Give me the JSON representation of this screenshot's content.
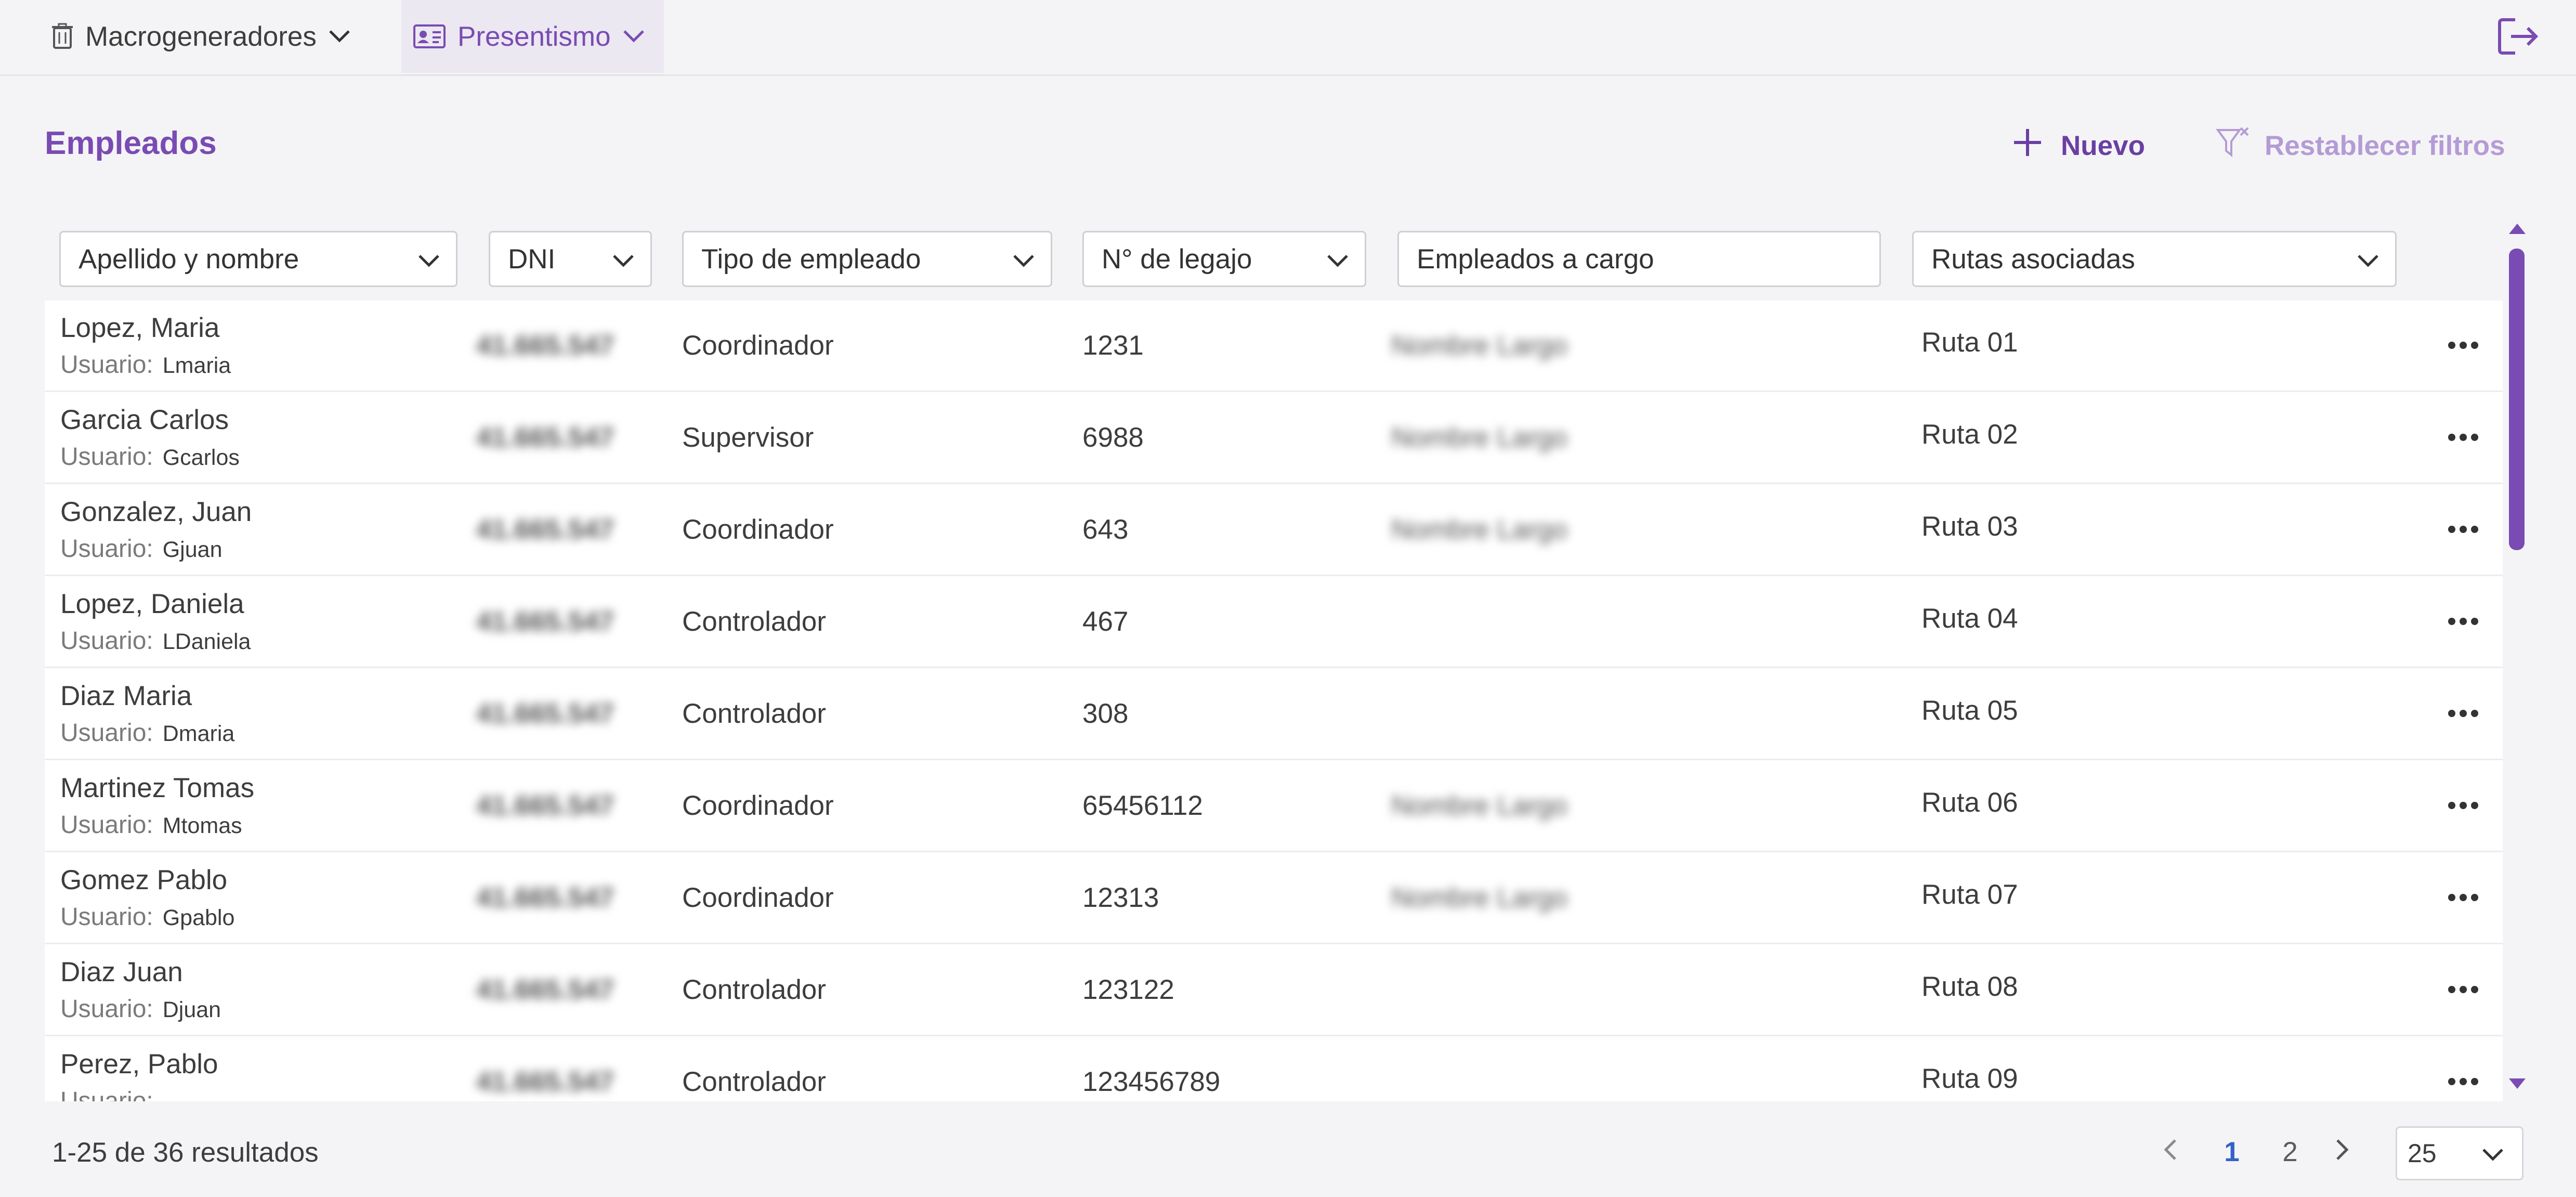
{
  "nav": {
    "item1": {
      "label": "Macrogeneradores",
      "icon": "trash-icon"
    },
    "item2": {
      "label": "Presentismo",
      "icon": "id-card-icon"
    }
  },
  "header": {
    "title": "Empleados",
    "new_label": "Nuevo",
    "reset_label": "Restablecer filtros"
  },
  "filters": {
    "name": "Apellido y nombre",
    "dni": "DNI",
    "tipo": "Tipo de empleado",
    "legajo": "N° de legajo",
    "a_cargo": "Empleados a cargo",
    "rutas": "Rutas asociadas"
  },
  "user_label": "Usuario:",
  "rows": [
    {
      "name": "Lopez, Maria",
      "user": "Lmaria",
      "dni": "41.665.547",
      "tipo": "Coordinador",
      "legajo": "1231",
      "a_cargo": "Nombre Largo",
      "ruta": "Ruta 01"
    },
    {
      "name": "Garcia Carlos",
      "user": "Gcarlos",
      "dni": "41.665.547",
      "tipo": "Supervisor",
      "legajo": "6988",
      "a_cargo": "Nombre Largo",
      "ruta": "Ruta 02"
    },
    {
      "name": "Gonzalez, Juan",
      "user": "Gjuan",
      "dni": "41.665.547",
      "tipo": "Coordinador",
      "legajo": "643",
      "a_cargo": "Nombre Largo",
      "ruta": "Ruta 03"
    },
    {
      "name": "Lopez, Daniela",
      "user": "LDaniela",
      "dni": "41.665.547",
      "tipo": "Controlador",
      "legajo": "467",
      "a_cargo": "",
      "ruta": "Ruta 04"
    },
    {
      "name": "Diaz Maria",
      "user": "Dmaria",
      "dni": "41.665.547",
      "tipo": "Controlador",
      "legajo": "308",
      "a_cargo": "",
      "ruta": "Ruta 05"
    },
    {
      "name": "Martinez Tomas",
      "user": "Mtomas",
      "dni": "41.665.547",
      "tipo": "Coordinador",
      "legajo": "65456112",
      "a_cargo": "Nombre Largo",
      "ruta": "Ruta 06"
    },
    {
      "name": "Gomez Pablo",
      "user": "Gpablo",
      "dni": "41.665.547",
      "tipo": "Coordinador",
      "legajo": "12313",
      "a_cargo": "Nombre Largo",
      "ruta": "Ruta 07"
    },
    {
      "name": "Diaz Juan",
      "user": "Djuan",
      "dni": "41.665.547",
      "tipo": "Controlador",
      "legajo": "123122",
      "a_cargo": "",
      "ruta": "Ruta 08"
    },
    {
      "name": "Perez, Pablo",
      "user": "",
      "dni": "41.665.547",
      "tipo": "Controlador",
      "legajo": "123456789",
      "a_cargo": "",
      "ruta": "Ruta 09"
    }
  ],
  "footer": {
    "results": "1-25 de 36 resultados",
    "pages": [
      "1",
      "2"
    ],
    "current_page": "1",
    "per_page": "25"
  },
  "colors": {
    "accent": "#7a4bb3",
    "accent_light": "#b49bd5",
    "active_page": "#3560c7"
  }
}
